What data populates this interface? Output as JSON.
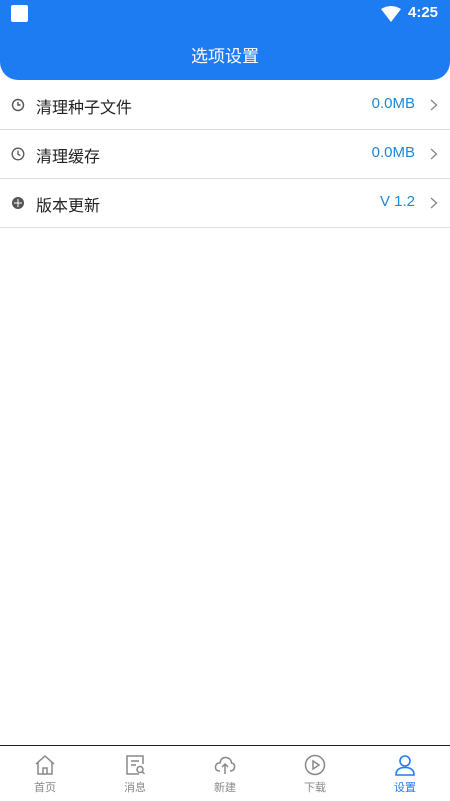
{
  "status_bar": {
    "time": "4:25"
  },
  "header": {
    "title": "选项设置"
  },
  "settings": [
    {
      "label": "清理种子文件",
      "value": "0.0MB",
      "icon": "clean-icon"
    },
    {
      "label": "清理缓存",
      "value": "0.0MB",
      "icon": "clock-icon"
    },
    {
      "label": "版本更新",
      "value": "V 1.2",
      "icon": "update-icon"
    }
  ],
  "tabs": [
    {
      "label": "首页",
      "icon": "home-icon"
    },
    {
      "label": "消息",
      "icon": "message-icon"
    },
    {
      "label": "新建",
      "icon": "upload-cloud-icon"
    },
    {
      "label": "下载",
      "icon": "play-circle-icon"
    },
    {
      "label": "设置",
      "icon": "user-icon",
      "active": true
    }
  ],
  "colors": {
    "accent": "#1e7cf2",
    "value_text": "#1e88d6",
    "inactive_tab": "#888888"
  }
}
